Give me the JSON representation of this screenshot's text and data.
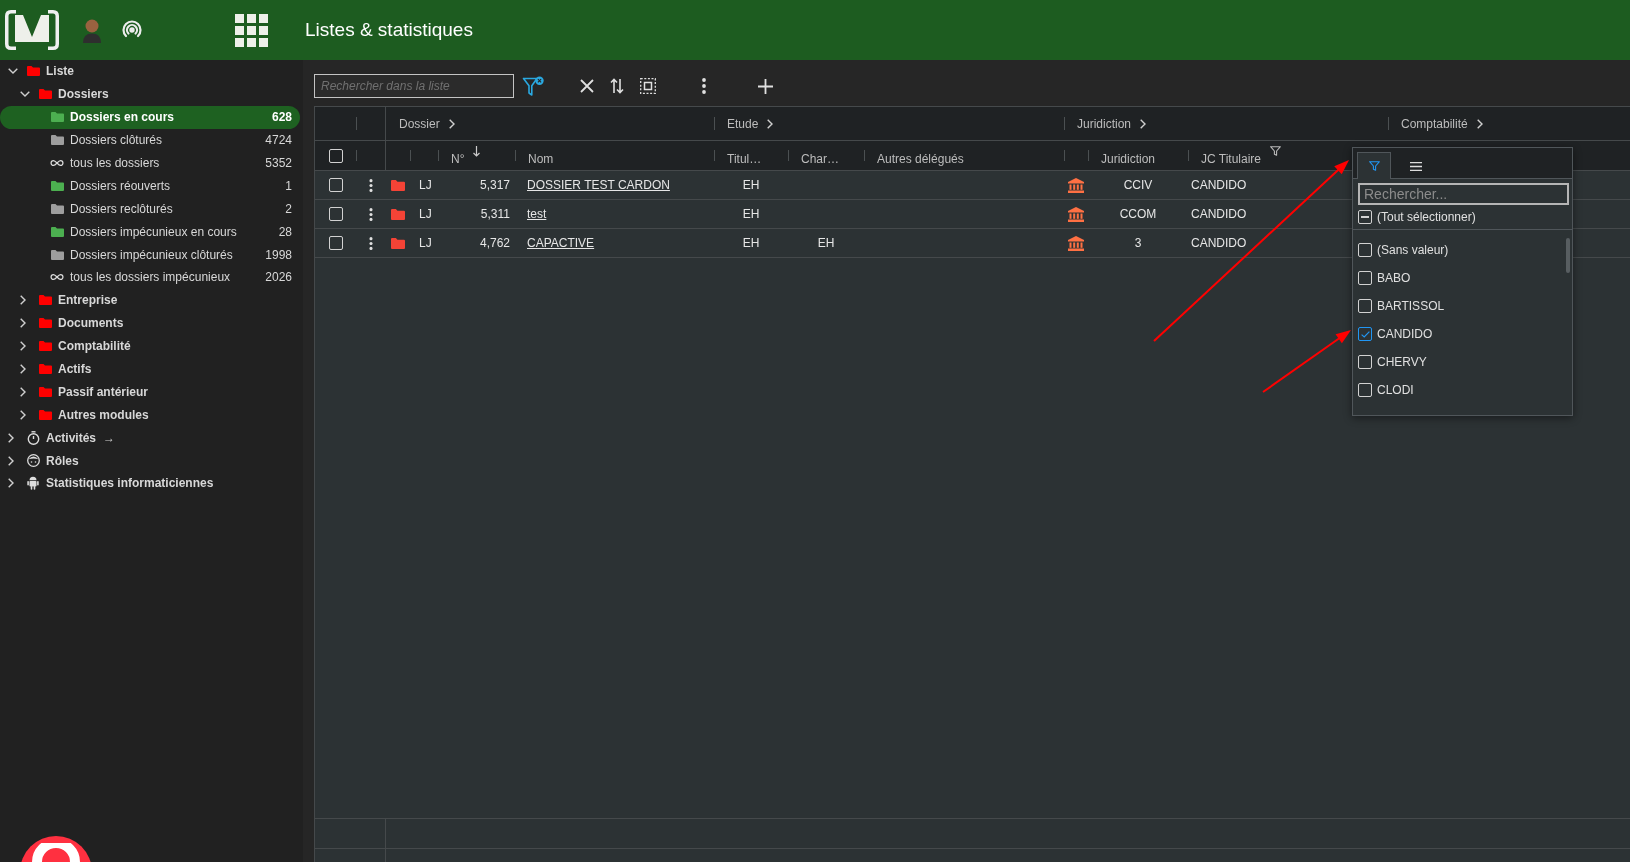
{
  "header": {
    "title": "Listes & statistiques"
  },
  "sidebar": {
    "tree": [
      {
        "label": "Liste",
        "kind": "folder",
        "color": "#ff0000",
        "expanded": true,
        "selected": false,
        "children": [
          {
            "label": "Dossiers",
            "kind": "folder",
            "color": "#ff0000",
            "expanded": true,
            "selected": false,
            "children": [
              {
                "label": "Dossiers en cours",
                "kind": "folder",
                "color": "#4caf50",
                "count": "628",
                "selected": true
              },
              {
                "label": "Dossiers clôturés",
                "kind": "folder",
                "color": "#9e9e9e",
                "count": "4724",
                "selected": false
              },
              {
                "label": "tous les dossiers",
                "kind": "infinity",
                "count": "5352",
                "selected": false
              },
              {
                "label": "Dossiers réouverts",
                "kind": "folder",
                "color": "#4caf50",
                "count": "1",
                "selected": false
              },
              {
                "label": "Dossiers reclôturés",
                "kind": "folder",
                "color": "#9e9e9e",
                "count": "2",
                "selected": false
              },
              {
                "label": "Dossiers impécunieux en cours",
                "kind": "folder",
                "color": "#4caf50",
                "count": "28",
                "selected": false
              },
              {
                "label": "Dossiers impécunieux clôturés",
                "kind": "folder",
                "color": "#9e9e9e",
                "count": "1998",
                "selected": false
              },
              {
                "label": "tous les dossiers impécunieux",
                "kind": "infinity",
                "count": "2026",
                "selected": false
              }
            ]
          },
          {
            "label": "Entreprise",
            "kind": "folder",
            "color": "#ff0000",
            "expanded": false,
            "selected": false
          },
          {
            "label": "Documents",
            "kind": "folder",
            "color": "#ff0000",
            "expanded": false,
            "selected": false
          },
          {
            "label": "Comptabilité",
            "kind": "folder",
            "color": "#ff0000",
            "expanded": false,
            "selected": false
          },
          {
            "label": "Actifs",
            "kind": "folder",
            "color": "#ff0000",
            "expanded": false,
            "selected": false
          },
          {
            "label": "Passif antérieur",
            "kind": "folder",
            "color": "#ff0000",
            "expanded": false,
            "selected": false
          },
          {
            "label": "Autres modules",
            "kind": "folder",
            "color": "#ff0000",
            "expanded": false,
            "selected": false
          }
        ]
      },
      {
        "label": "Activités",
        "suffix": "→",
        "kind": "timer",
        "expanded": false,
        "selected": false
      },
      {
        "label": "Rôles",
        "kind": "face",
        "expanded": false,
        "selected": false
      },
      {
        "label": "Statistiques informaticiennes",
        "kind": "robot",
        "expanded": false,
        "selected": false
      }
    ]
  },
  "toolbar": {
    "search": {
      "placeholder": "Rechercher dans la liste"
    },
    "buttons": [
      {
        "kind": "filter-clear"
      },
      {
        "kind": "clear"
      },
      {
        "kind": "sort"
      },
      {
        "kind": "select"
      },
      {
        "kind": "more"
      },
      {
        "kind": "add"
      }
    ]
  },
  "table": {
    "select_all": {
      "checked": false
    },
    "column_groups": [
      {
        "label": "Dossier"
      },
      {
        "label": "Etude"
      },
      {
        "label": "Juridiction"
      },
      {
        "label": "Comptabilité"
      }
    ],
    "columns": [
      {
        "label": "N°",
        "sorted": true,
        "filtered": false
      },
      {
        "label": "Nom",
        "sorted": false,
        "filtered": false
      },
      {
        "label": "Titul…",
        "sorted": false,
        "filtered": false
      },
      {
        "label": "Char…",
        "sorted": false,
        "filtered": false
      },
      {
        "label": "Autres délégués",
        "sorted": false,
        "filtered": false
      },
      {
        "label": "Juridiction",
        "sorted": false,
        "filtered": false
      },
      {
        "label": "JC Titulaire",
        "sorted": false,
        "filtered": true
      }
    ],
    "rows": [
      {
        "checked": false,
        "column_4": "LJ",
        "number": "5,317",
        "name": "DOSSIER TEST CARDON",
        "titulaire": "EH",
        "juridiction": "CCIV",
        "jc_titulaire": "CANDIDO"
      },
      {
        "checked": false,
        "column_4": "LJ",
        "number": "5,311",
        "name": "test",
        "titulaire": "EH",
        "juridiction": "CCOM",
        "jc_titulaire": "CANDIDO"
      },
      {
        "checked": false,
        "column_4": "LJ",
        "number": "4,762",
        "name": "CAPACTIVE",
        "titulaire": "EH",
        "charge": "EH",
        "juridiction": "3",
        "jc_titulaire": "CANDIDO"
      }
    ]
  },
  "filter_popup": {
    "tabs": [
      {
        "kind": "filter",
        "selected": true
      },
      {
        "kind": "columns",
        "selected": false
      }
    ],
    "search": {
      "placeholder": "Rechercher..."
    },
    "select_all": {
      "label": "(Tout sélectionner)",
      "indeterminate": true
    },
    "options": [
      {
        "label": "(Sans valeur)",
        "checked": false
      },
      {
        "label": "BABO",
        "checked": false
      },
      {
        "label": "BARTISSOL",
        "checked": false
      },
      {
        "label": "CANDIDO",
        "checked": true
      },
      {
        "label": "CHERVY",
        "checked": false
      },
      {
        "label": "CLODI",
        "checked": false
      }
    ]
  },
  "annotations": [
    {
      "kind": "arrow"
    },
    {
      "kind": "arrow"
    }
  ]
}
